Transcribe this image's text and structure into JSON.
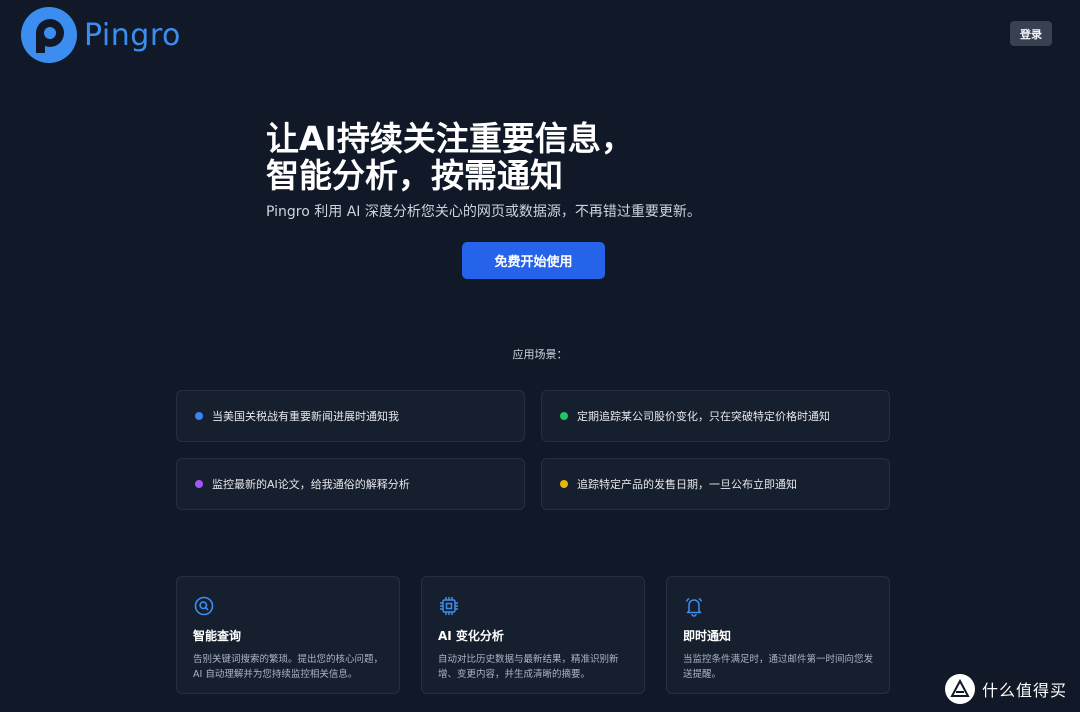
{
  "brand": {
    "name": "Pingro"
  },
  "header": {
    "login_label": "登录"
  },
  "hero": {
    "title_line1": "让AI持续关注重要信息，",
    "title_line2": "智能分析，按需通知",
    "subtitle": "Pingro 利用 AI 深度分析您关心的网页或数据源，不再错过重要更新。",
    "cta_label": "免费开始使用"
  },
  "scenarios": {
    "label": "应用场景：",
    "items": [
      {
        "text": "当美国关税战有重要新闻进展时通知我",
        "color": "#3b82f6"
      },
      {
        "text": "定期追踪某公司股价变化，只在突破特定价格时通知",
        "color": "#22c55e"
      },
      {
        "text": "监控最新的AI论文，给我通俗的解释分析",
        "color": "#a855f7"
      },
      {
        "text": "追踪特定产品的发售日期，一旦公布立即通知",
        "color": "#eab308"
      }
    ]
  },
  "features": [
    {
      "icon": "search-icon",
      "title": "智能查询",
      "desc": "告别关键词搜索的繁琐。提出您的核心问题，AI 自动理解并为您持续监控相关信息。"
    },
    {
      "icon": "cpu-chip-icon",
      "title": "AI 变化分析",
      "desc": "自动对比历史数据与最新结果，精准识别新增、变更内容，并生成清晰的摘要。"
    },
    {
      "icon": "bell-icon",
      "title": "即时通知",
      "desc": "当监控条件满足时，通过邮件第一时间向您发送提醒。"
    }
  ],
  "watermark": {
    "text": "什么值得买",
    "icon_char": "值"
  },
  "colors": {
    "background": "#111827",
    "accent": "#2563eb",
    "icon_blue": "#3b8ef0"
  }
}
